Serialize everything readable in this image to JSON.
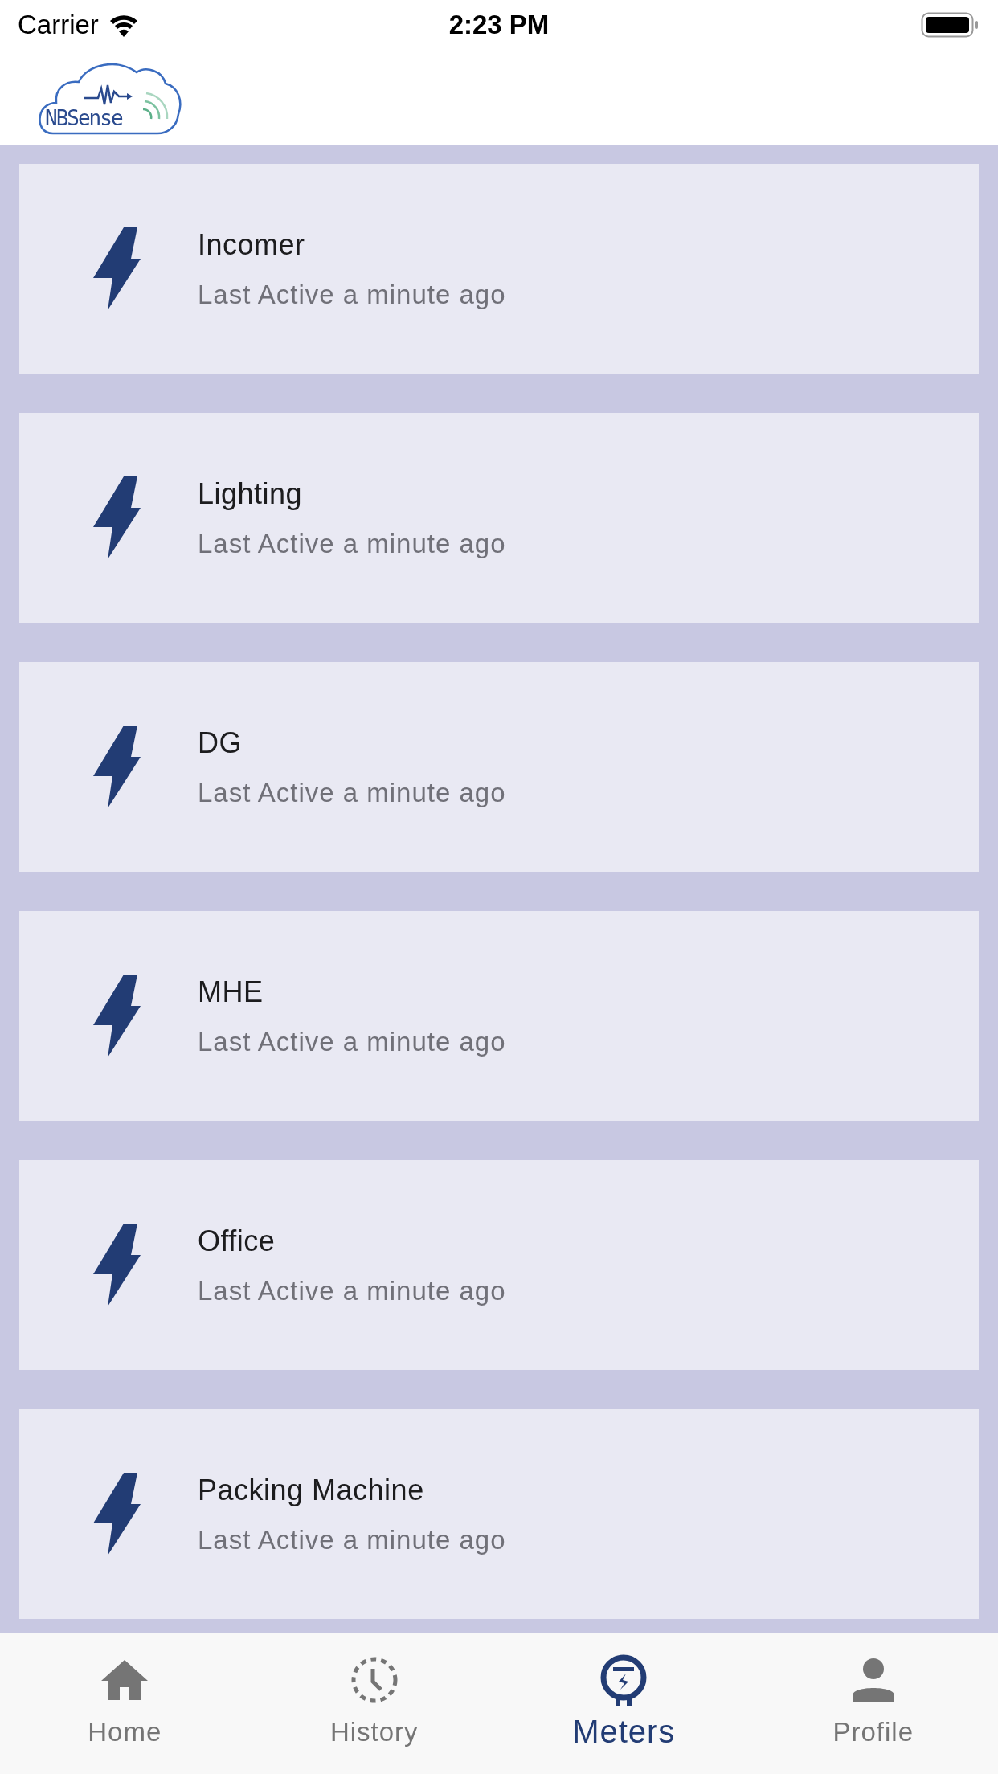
{
  "status_bar": {
    "carrier": "Carrier",
    "time": "2:23 PM"
  },
  "header": {
    "logo_text": "NBSense"
  },
  "meters": [
    {
      "name": "Incomer",
      "status": "Last Active a minute ago"
    },
    {
      "name": "Lighting",
      "status": "Last Active a minute ago"
    },
    {
      "name": "DG",
      "status": "Last Active a minute ago"
    },
    {
      "name": "MHE",
      "status": "Last Active a minute ago"
    },
    {
      "name": "Office",
      "status": "Last Active a minute ago"
    },
    {
      "name": "Packing Machine",
      "status": "Last Active a minute ago"
    }
  ],
  "tabs": [
    {
      "label": "Home",
      "kind": "home",
      "selected": false
    },
    {
      "label": "History",
      "kind": "history",
      "selected": false
    },
    {
      "label": "Meters",
      "kind": "meters",
      "selected": true
    },
    {
      "label": "Profile",
      "kind": "profile",
      "selected": false
    }
  ]
}
